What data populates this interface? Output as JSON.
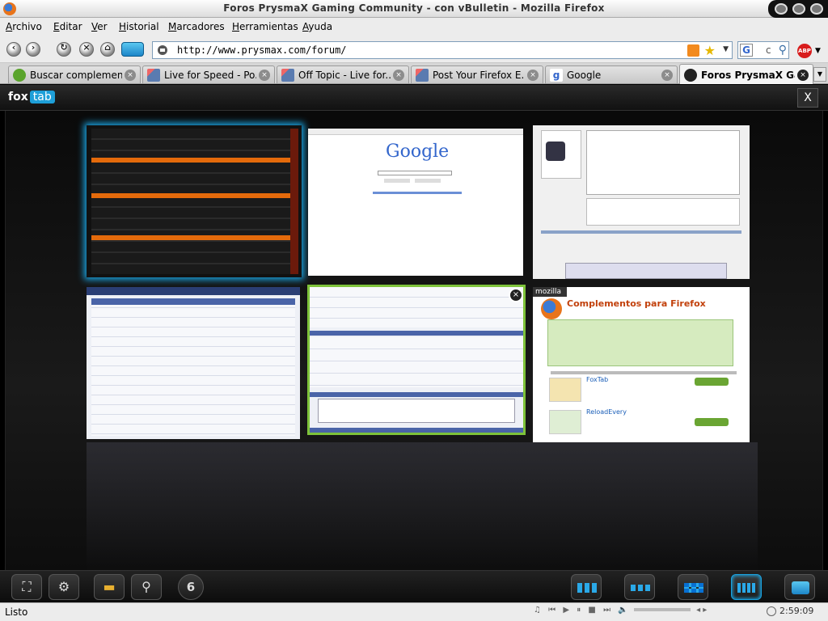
{
  "window": {
    "title": "Foros PrysmaX Gaming Community - con vBulletin - Mozilla Firefox"
  },
  "menu": [
    "Archivo",
    "Editar",
    "Ver",
    "Historial",
    "Marcadores",
    "Herramientas",
    "Ayuda"
  ],
  "nav": {
    "url": "http://www.prysmax.com/forum/",
    "search_text": "c",
    "abp_label": "ABP"
  },
  "tabs": [
    {
      "label": "Buscar complemen...",
      "favicon_color": "#5aa42c",
      "active": false
    },
    {
      "label": "Live for Speed - Po...",
      "favicon_color": "#5a7bb0",
      "active": false
    },
    {
      "label": "Off Topic - Live for...",
      "favicon_color": "#5a7bb0",
      "active": false
    },
    {
      "label": "Post Your Firefox E...",
      "favicon_color": "#5a7bb0",
      "active": false
    },
    {
      "label": "Google",
      "favicon_color": "#3366cc",
      "active": false
    },
    {
      "label": "Foros PrysmaX Ga...",
      "favicon_color": "#222222",
      "active": true
    }
  ],
  "foxtab": {
    "logo_fox": "fox",
    "logo_tab": "tab",
    "close_label": "X",
    "tab_count": "6",
    "google_logo": "Google",
    "mozilla_label": "mozilla",
    "mozilla_heading": "Complementos para Firefox",
    "mozilla_item1": "FoxTab",
    "mozilla_item2": "ReloadEvery",
    "accent": "#1aa3e0",
    "selected_green": "#7ec33a"
  },
  "status": {
    "text": "Listo",
    "time": "2:59:09"
  }
}
